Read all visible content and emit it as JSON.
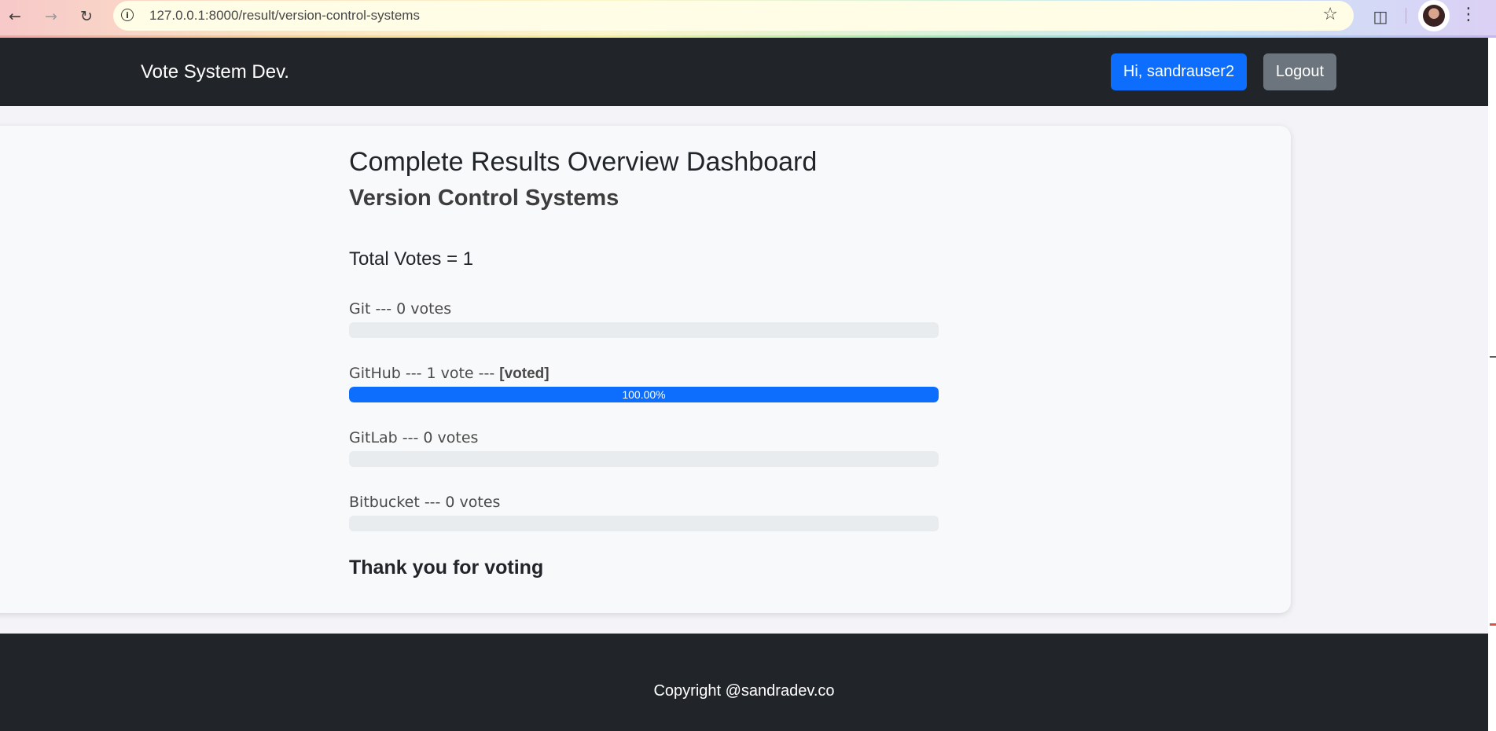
{
  "browser": {
    "url": "127.0.0.1:8000/result/version-control-systems"
  },
  "navbar": {
    "brand": "Vote System Dev.",
    "user_button": "Hi, sandrauser2",
    "logout_button": "Logout"
  },
  "page": {
    "title": "Complete Results Overview Dashboard",
    "poll_name": "Version Control Systems",
    "total_votes": "Total Votes = 1",
    "choices": [
      {
        "label": "Git --- 0 votes",
        "voted": "",
        "percent": 0,
        "percent_label": ""
      },
      {
        "label": "GitHub --- 1 vote --- ",
        "voted": "[voted]",
        "percent": 100,
        "percent_label": "100.00%"
      },
      {
        "label": "GitLab --- 0 votes",
        "voted": "",
        "percent": 0,
        "percent_label": ""
      },
      {
        "label": "Bitbucket --- 0 votes",
        "voted": "",
        "percent": 0,
        "percent_label": ""
      }
    ],
    "thank_you": "Thank you for voting"
  },
  "footer": {
    "copyright": "Copyright @sandradev.co"
  },
  "icons": {
    "back": "arrow-left-icon",
    "forward": "arrow-right-icon",
    "reload": "reload-icon",
    "site_info": "info-icon",
    "bookmark": "star-icon",
    "extensions": "puzzle-icon",
    "profile": "avatar",
    "menu": "kebab-menu-icon"
  },
  "colors": {
    "primary": "#0d6efd",
    "secondary": "#6c757d",
    "dark": "#212529"
  }
}
